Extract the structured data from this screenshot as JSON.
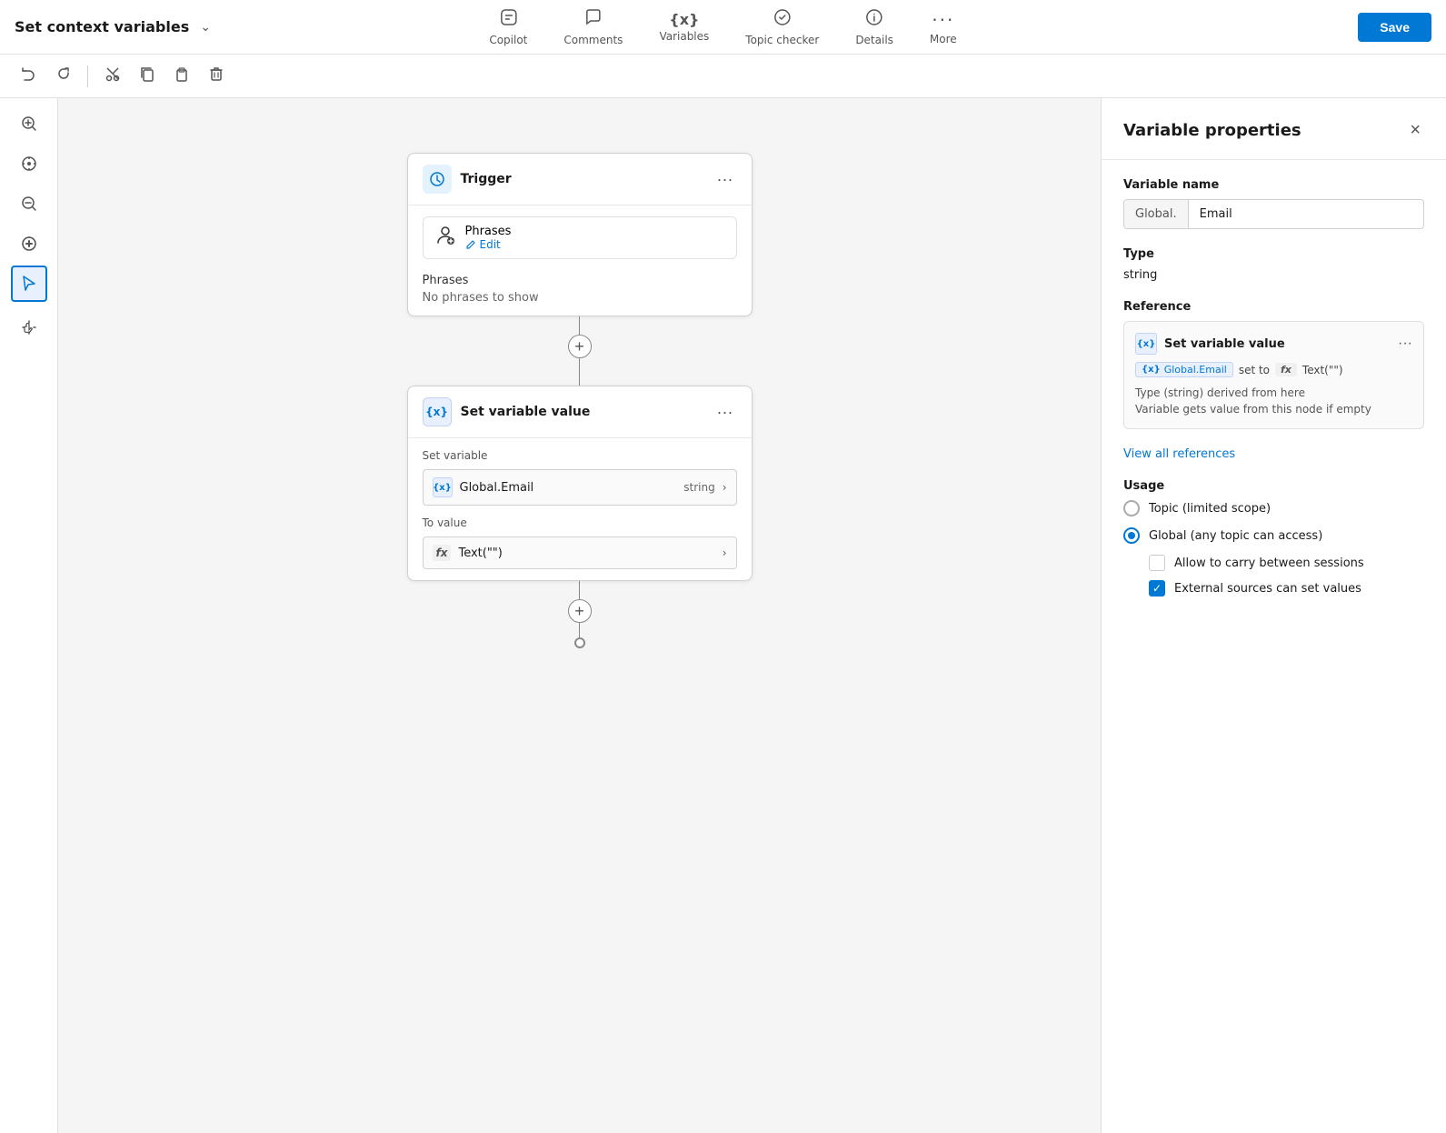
{
  "header": {
    "title": "Set context variables",
    "nav": [
      {
        "id": "copilot",
        "label": "Copilot",
        "icon": "⊟"
      },
      {
        "id": "comments",
        "label": "Comments",
        "icon": "💬"
      },
      {
        "id": "variables",
        "label": "Variables",
        "icon": "{x}"
      },
      {
        "id": "topic_checker",
        "label": "Topic checker",
        "icon": "🩺"
      },
      {
        "id": "details",
        "label": "Details",
        "icon": "ℹ"
      },
      {
        "id": "more",
        "label": "More",
        "icon": "···"
      }
    ],
    "save_label": "Save"
  },
  "toolbar": {
    "undo": "↩",
    "redo": "↪",
    "cut": "✂",
    "copy": "⧉",
    "paste": "📋",
    "delete": "🗑"
  },
  "canvas": {
    "trigger_card": {
      "title": "Trigger",
      "phrases_label": "Phrases",
      "phrases_edit": "Edit",
      "phrases_empty_title": "Phrases",
      "phrases_empty_text": "No phrases to show"
    },
    "set_variable_card": {
      "title": "Set variable value",
      "set_variable_label": "Set variable",
      "var_icon": "{x}",
      "var_name": "Global.Email",
      "var_type": "string",
      "to_value_label": "To value",
      "to_value_text": "Text(\"\")"
    }
  },
  "right_panel": {
    "title": "Variable properties",
    "close_label": "×",
    "var_name_label": "Variable name",
    "var_prefix": "Global.",
    "var_name": "Email",
    "type_label": "Type",
    "type_value": "string",
    "reference_label": "Reference",
    "ref_card": {
      "title": "Set variable value",
      "detail_var": "Global.Email",
      "set_to_label": "set to",
      "fx_value": "Text(\"\")",
      "note_line1": "Type (string) derived from here",
      "note_line2": "Variable gets value from this node if empty"
    },
    "view_refs_label": "View all references",
    "usage_label": "Usage",
    "usage_options": [
      {
        "id": "topic",
        "label": "Topic (limited scope)",
        "selected": false
      },
      {
        "id": "global",
        "label": "Global (any topic can access)",
        "selected": true
      }
    ],
    "checkboxes": [
      {
        "id": "carry",
        "label": "Allow to carry between sessions",
        "checked": false
      },
      {
        "id": "external",
        "label": "External sources can set values",
        "checked": true
      }
    ]
  },
  "sidebar_tools": [
    {
      "id": "zoom-in",
      "icon": "⊕",
      "label": "Zoom in"
    },
    {
      "id": "center",
      "icon": "◎",
      "label": "Center"
    },
    {
      "id": "zoom-out",
      "icon": "⊖",
      "label": "Zoom out"
    },
    {
      "id": "no-entry",
      "icon": "⊘",
      "label": "Fit"
    },
    {
      "id": "select",
      "icon": "↖",
      "label": "Select",
      "active": true
    },
    {
      "id": "pan",
      "icon": "✋",
      "label": "Pan"
    }
  ]
}
